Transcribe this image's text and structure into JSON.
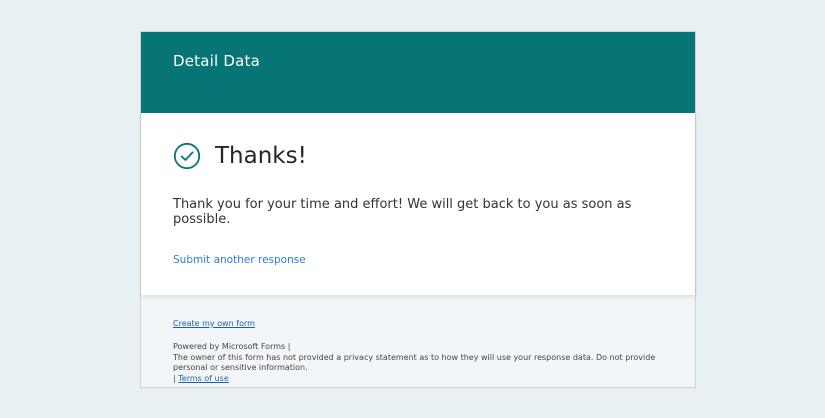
{
  "header": {
    "title": "Detail Data",
    "background_color": "#077576"
  },
  "confirmation": {
    "icon": "check-circle-icon",
    "title": "Thanks!",
    "message": "Thank you for your time and effort! We will get back to you as soon as possible.",
    "submit_another_label": "Submit another response"
  },
  "footer": {
    "create_form_label": "Create my own form",
    "powered_by": "Powered by Microsoft Forms |",
    "privacy_notice": "The owner of this form has not provided a privacy statement as to how they will use your response data. Do not provide personal or sensitive information.",
    "terms_separator": "|",
    "terms_label": "Terms of use"
  },
  "colors": {
    "accent": "#077576",
    "link": "#2b7cd3",
    "page_background": "#e8f0f4"
  }
}
